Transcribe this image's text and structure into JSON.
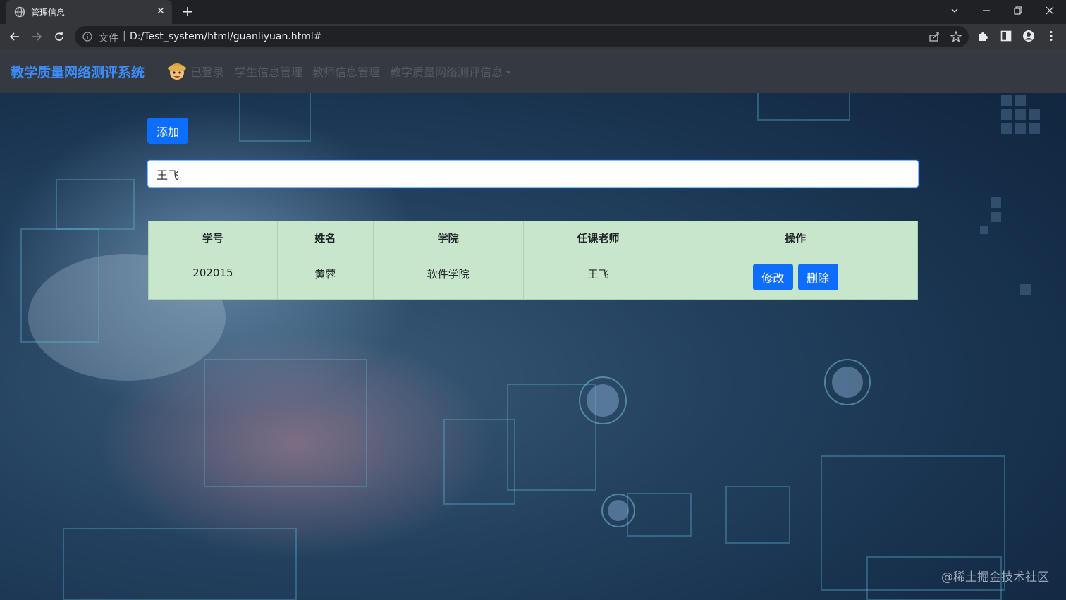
{
  "browser": {
    "tab_title": "管理信息",
    "url_scheme": "文件",
    "url_separator": "|",
    "url": "D:/Test_system/html/guanliyuan.html#"
  },
  "navbar": {
    "brand": "教学质量网络测评系统",
    "logged_in": "已登录",
    "links": [
      "学生信息管理",
      "教师信息管理",
      "教学质量网络测评信息"
    ]
  },
  "toolbar": {
    "add_label": "添加"
  },
  "search": {
    "value": "王飞"
  },
  "table": {
    "headers": [
      "学号",
      "姓名",
      "学院",
      "任课老师",
      "操作"
    ],
    "rows": [
      {
        "id": "202015",
        "name": "黄蓉",
        "college": "软件学院",
        "teacher": "王飞"
      }
    ],
    "edit_label": "修改",
    "delete_label": "删除"
  },
  "watermark": "@稀土掘金技术社区",
  "colors": {
    "primary": "#0d6efd",
    "brand": "#3d8bfd",
    "navbar_bg": "#343a40",
    "table_bg": "#c7e6cc"
  }
}
